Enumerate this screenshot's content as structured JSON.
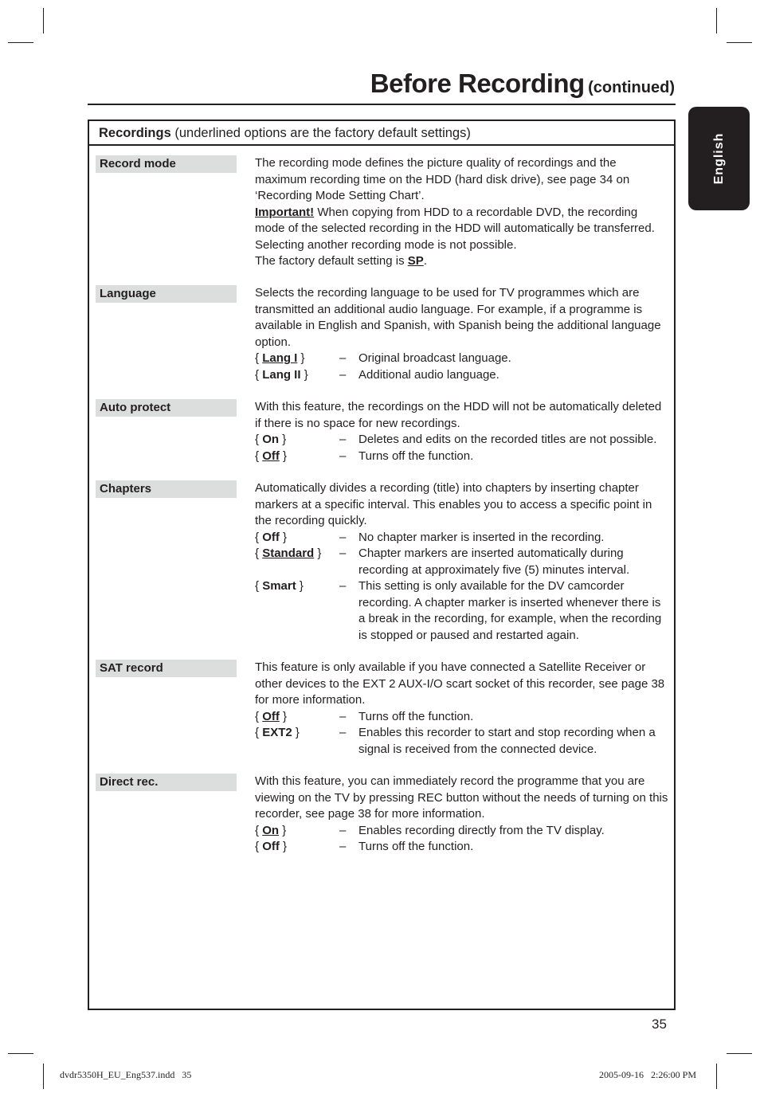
{
  "header": {
    "title": "Before Recording",
    "subtitle": "(continued)"
  },
  "side_tab": {
    "label": "English"
  },
  "box": {
    "heading_bold": "Recordings",
    "heading_rest": " (underlined options are the factory default settings)"
  },
  "settings": [
    {
      "label": "Record mode",
      "paragraphs": [
        "The recording mode defines the picture quality of recordings and the maximum recording time on the HDD (hard disk drive), see page 34 on ‘Recording Mode Setting Chart’."
      ],
      "important_label": "Important!",
      "important_text": " When copying from HDD to a recordable DVD, the recording mode of the selected recording in the HDD will automatically be transferred. Selecting another recording mode is not possible.",
      "default_prefix": "The factory default setting is ",
      "default_value": "SP",
      "default_suffix": "."
    },
    {
      "label": "Language",
      "paragraphs": [
        "Selects the recording language to be used for TV programmes which are transmitted an additional audio language. For example, if a programme is available in English and Spanish, with Spanish being the additional language option."
      ],
      "options": [
        {
          "key": "Lang I",
          "default": true,
          "desc": "Original broadcast language."
        },
        {
          "key": "Lang II",
          "default": false,
          "desc": "Additional audio language."
        }
      ]
    },
    {
      "label": "Auto protect",
      "paragraphs": [
        "With this feature, the recordings on the HDD will not be automatically deleted if there is no space for new recordings."
      ],
      "options": [
        {
          "key": "On",
          "default": false,
          "desc": "Deletes and edits on the recorded titles are not possible."
        },
        {
          "key": "Off",
          "default": true,
          "desc": "Turns off the function."
        }
      ]
    },
    {
      "label": "Chapters",
      "paragraphs": [
        "Automatically divides a recording (title) into chapters by inserting chapter markers at a specific interval. This enables you to access a specific point in the recording quickly."
      ],
      "options": [
        {
          "key": "Off",
          "default": false,
          "desc": "No chapter marker is inserted in the recording."
        },
        {
          "key": "Standard",
          "default": true,
          "desc": "Chapter markers are inserted automatically during recording at approximately five (5) minutes interval."
        },
        {
          "key": "Smart",
          "default": false,
          "desc": "This setting is only available for the DV camcorder recording. A chapter marker is inserted whenever there is a break in the recording, for example, when the recording is stopped or paused and restarted again."
        }
      ]
    },
    {
      "label": "SAT record",
      "paragraphs": [
        "This feature is only available if you have connected a Satellite Receiver or other devices to the EXT 2 AUX-I/O scart socket of this recorder, see page 38 for more information."
      ],
      "options": [
        {
          "key": "Off",
          "default": true,
          "desc": "Turns off the function."
        },
        {
          "key": "EXT2",
          "default": false,
          "desc": "Enables this recorder to start and stop recording when a signal is received from the connected device."
        }
      ]
    },
    {
      "label": "Direct rec.",
      "paragraphs": [
        "With this feature, you can immediately record the programme that you are viewing on the TV by pressing REC button without the needs of turning on this recorder, see page 38 for more information."
      ],
      "options": [
        {
          "key": "On",
          "default": true,
          "desc": "Enables recording directly from the TV display."
        },
        {
          "key": "Off",
          "default": false,
          "desc": "Turns off the function."
        }
      ]
    }
  ],
  "symbols": {
    "brace_open": "{ ",
    "brace_close": " }",
    "dash": "–"
  },
  "page_number": "35",
  "footer": {
    "left": "dvdr5350H_EU_Eng537.indd   35",
    "right": "2005-09-16   2:26:00 PM"
  }
}
